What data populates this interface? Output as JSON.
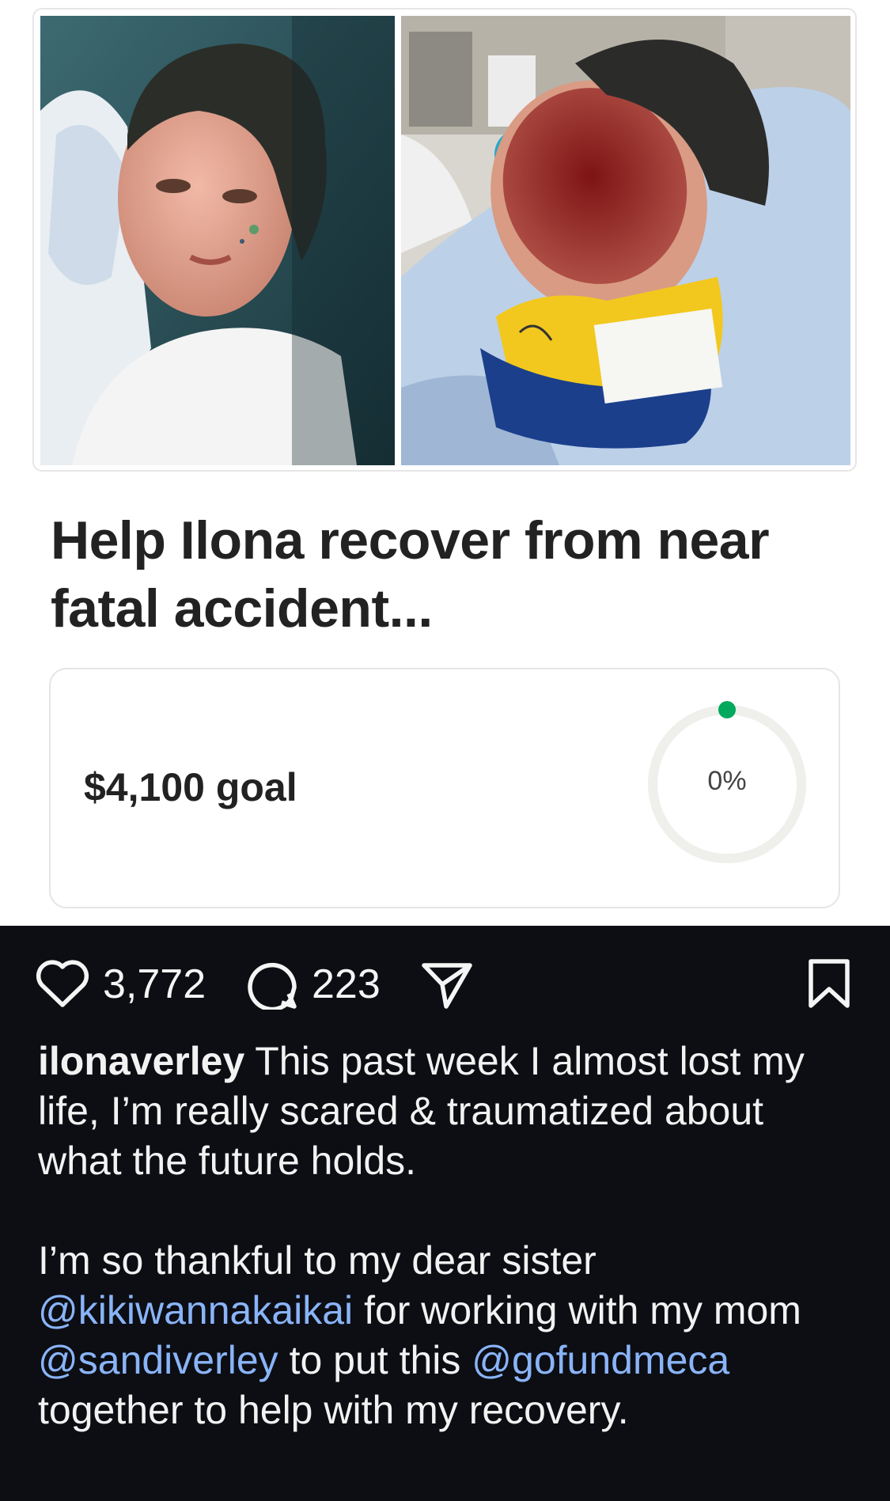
{
  "fundraiser": {
    "title": "Help Ilona recover from near fatal accident...",
    "goal_text": "$4,100 goal",
    "progress_text": "0%",
    "progress_fraction": 0.0,
    "accent_color": "#02a95c"
  },
  "post": {
    "likes": "3,772",
    "comments": "223",
    "username": "ilonaverley",
    "caption_p1": "This past week I almost lost my life, I’m really scared & traumatized about what the future holds.",
    "caption_p2_a": "I’m so thankful to my dear sister",
    "mention_1": "@kikiwannakaikai",
    "caption_p2_b": "for working with my mom",
    "mention_2": "@sandiverley",
    "caption_p2_c": "to put this",
    "mention_3": "@gofundmeca",
    "caption_p2_d": "together to help with my recovery."
  },
  "icons": {
    "like": "heart-icon",
    "comment": "comment-icon",
    "share": "paper-plane-icon",
    "save": "bookmark-icon"
  }
}
